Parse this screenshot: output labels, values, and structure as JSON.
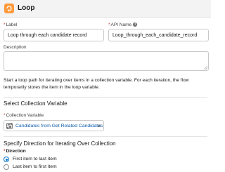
{
  "header": {
    "title": "Loop",
    "icon": "loop-icon",
    "icon_color": "#ff9a3c"
  },
  "fields": {
    "label": {
      "label": "Label",
      "value": "Loop through each candidate record",
      "required": true
    },
    "api_name": {
      "label": "API Name",
      "value": "Loop_through_each_candidate_record",
      "required": true
    },
    "description": {
      "label": "Description",
      "value": ""
    }
  },
  "help_text": "Start a loop path for iterating over items in a collection variable. For each iteration, the flow temporarily stores the item in the loop variable.",
  "collection_section": {
    "title": "Select Collection Variable",
    "field_label": "Collection Variable",
    "selected_value": "Candidates from Get Related Candidates",
    "clear_icon": "close-icon"
  },
  "direction_section": {
    "title": "Specify Direction for Iterating Over Collection",
    "field_label": "Direction",
    "options": [
      {
        "label": "First item to last item",
        "selected": true
      },
      {
        "label": "Last item to first item",
        "selected": false
      }
    ]
  },
  "colors": {
    "accent": "#0176d3",
    "link": "#0b5cab",
    "required": "#c23934"
  }
}
